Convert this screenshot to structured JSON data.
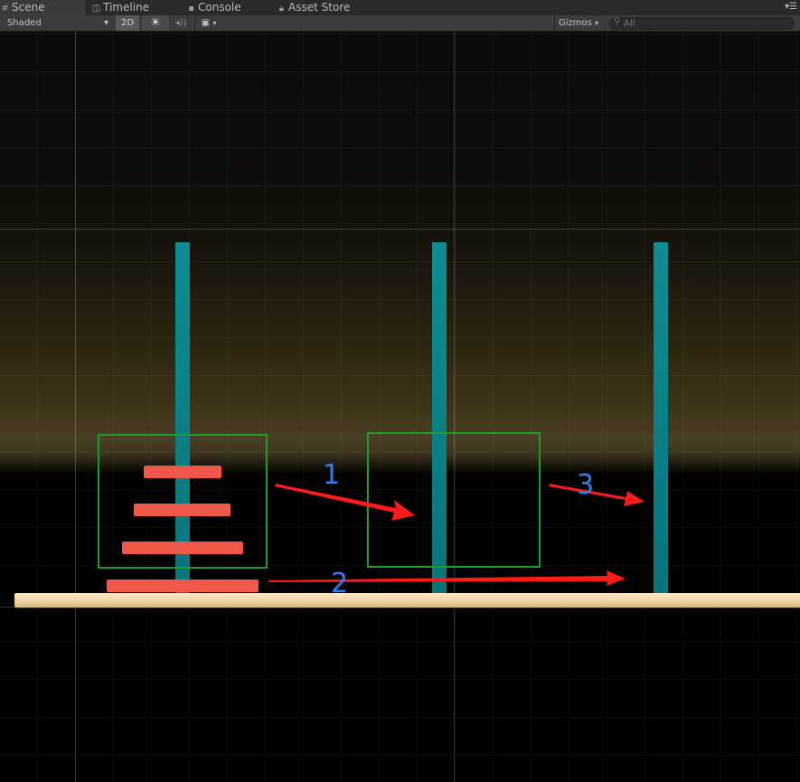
{
  "tabs": [
    {
      "label": "Scene",
      "icon": "scene-grid-icon"
    },
    {
      "label": "Timeline",
      "icon": "timeline-icon"
    },
    {
      "label": "Console",
      "icon": "console-icon"
    },
    {
      "label": "Asset Store",
      "icon": "lock-icon"
    }
  ],
  "toolbar": {
    "shading_mode": "Shaded",
    "mode_2d": "2D",
    "lighting_icon": "sun-icon",
    "audio_icon": "audio-icon",
    "effects_icon": "image-effects-icon",
    "gizmos_label": "Gizmos",
    "search_placeholder": "All"
  },
  "annotations": {
    "step1": "1",
    "step2": "2",
    "step3": "3",
    "annotation_color": "#2f7ff2",
    "arrow_color": "#ff1a1a",
    "box_color": "#1e9e28"
  },
  "scene": {
    "pole_color": "#0e8d93",
    "disc_color": "#f0584a",
    "base_color": "#f2d8a4",
    "disc_count_on_first_pole": 4
  }
}
